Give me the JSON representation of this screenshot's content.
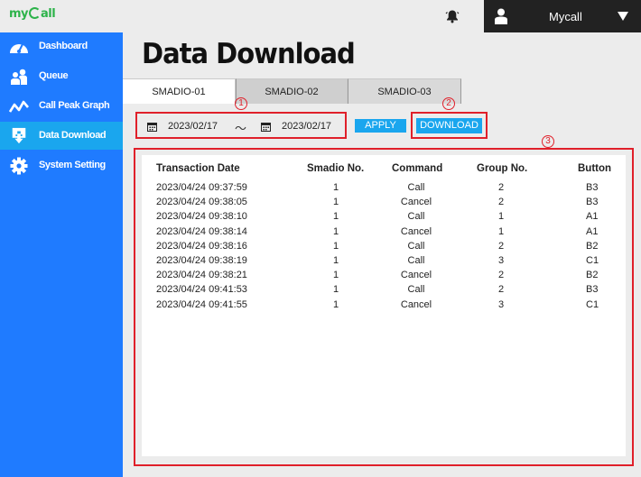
{
  "app": {
    "logo": "myCall"
  },
  "header": {
    "user_name": "Mycall",
    "icons": [
      "bell-icon",
      "user-icon",
      "caret-down-icon"
    ]
  },
  "sidebar": {
    "items": [
      {
        "label": "Dashboard",
        "icon": "gauge-icon",
        "active": false
      },
      {
        "label": "Queue",
        "icon": "people-icon",
        "active": false
      },
      {
        "label": "Call Peak Graph",
        "icon": "line-graph-icon",
        "active": false
      },
      {
        "label": "Data Download",
        "icon": "download-icon",
        "active": true
      },
      {
        "label": "System Setting",
        "icon": "gear-icon",
        "active": false
      }
    ]
  },
  "page": {
    "title": "Data Download"
  },
  "tabs": [
    {
      "label": "SMADIO-01",
      "active": true
    },
    {
      "label": "SMADIO-02",
      "active": false
    },
    {
      "label": "SMADIO-03",
      "active": false
    }
  ],
  "filters": {
    "start_date": "2023/02/17",
    "separator": "～",
    "end_date": "2023/02/17",
    "apply_label": "APPLY",
    "download_label": "DOWNLOAD"
  },
  "annotations": {
    "mark1": "1",
    "mark2": "2",
    "mark3": "3"
  },
  "table": {
    "headers": [
      "Transaction Date",
      "Smadio No.",
      "Command",
      "Group No.",
      "Button"
    ],
    "rows": [
      [
        "2023/04/24 09:37:59",
        "1",
        "Call",
        "2",
        "B3"
      ],
      [
        "2023/04/24 09:38:05",
        "1",
        "Cancel",
        "2",
        "B3"
      ],
      [
        "2023/04/24 09:38:10",
        "1",
        "Call",
        "1",
        "A1"
      ],
      [
        "2023/04/24 09:38:14",
        "1",
        "Cancel",
        "1",
        "A1"
      ],
      [
        "2023/04/24 09:38:16",
        "1",
        "Call",
        "2",
        "B2"
      ],
      [
        "2023/04/24 09:38:19",
        "1",
        "Call",
        "3",
        "C1"
      ],
      [
        "2023/04/24 09:38:21",
        "1",
        "Cancel",
        "2",
        "B2"
      ],
      [
        "2023/04/24 09:41:53",
        "1",
        "Call",
        "2",
        "B3"
      ],
      [
        "2023/04/24 09:41:55",
        "1",
        "Cancel",
        "3",
        "C1"
      ]
    ]
  },
  "colors": {
    "sidebar": "#1f7bff",
    "active": "#1aa6ee",
    "annotation": "#e0202a",
    "logo": "#2db34a"
  }
}
